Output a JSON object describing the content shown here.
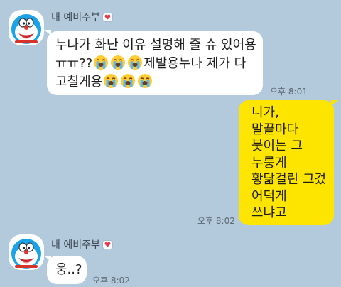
{
  "messages": [
    {
      "sender": "내 예비주부",
      "lines": [
        "누나가 화난 이유 설명해 줄 슈 있어용",
        "ㅠㅠ??",
        "제발용누나 제가 다",
        "고칠게용"
      ],
      "time": "오후 8:01"
    },
    {
      "lines": [
        "니가,",
        "말끝마다",
        "붓이는 그",
        "누룽게",
        "황닮걸린 그겄",
        "어덕게",
        "쓰냐고"
      ],
      "time": "오후 8:02"
    },
    {
      "sender": "내 예비주부",
      "lines": [
        "웅..?"
      ],
      "time": "오후 8:02"
    }
  ],
  "icons": {
    "avatar": "doraemon-avatar-icon",
    "badge": "heart-icon",
    "emoji": "loudly-crying-face-emoji"
  },
  "colors": {
    "background": "#b3c9dc",
    "incoming_bubble": "#ffffff",
    "outgoing_bubble": "#fee500",
    "heart": "#e8364f"
  }
}
